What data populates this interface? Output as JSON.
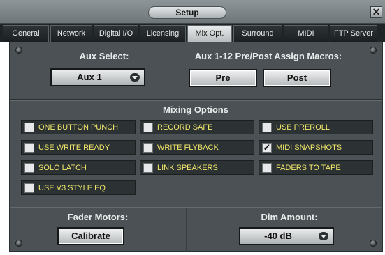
{
  "window": {
    "title": "Setup",
    "close_glyph": "✕"
  },
  "tabs": [
    {
      "label": "General",
      "active": false
    },
    {
      "label": "Network",
      "active": false
    },
    {
      "label": "Digital I/O",
      "active": false
    },
    {
      "label": "Licensing",
      "active": false
    },
    {
      "label": "Mix Opt.",
      "active": true
    },
    {
      "label": "Surround",
      "active": false
    },
    {
      "label": "MIDI",
      "active": false
    },
    {
      "label": "FTP Server",
      "active": false
    }
  ],
  "aux": {
    "select_heading": "Aux Select:",
    "select_value": "Aux 1",
    "macros_heading": "Aux 1-12 Pre/Post Assign Macros:",
    "pre_label": "Pre",
    "post_label": "Post"
  },
  "mixing": {
    "heading": "Mixing Options",
    "options": [
      {
        "label": "ONE BUTTON PUNCH",
        "checked": false
      },
      {
        "label": "RECORD SAFE",
        "checked": false
      },
      {
        "label": "USE PREROLL",
        "checked": false
      },
      {
        "label": "USE WRITE READY",
        "checked": false
      },
      {
        "label": "WRITE FLYBACK",
        "checked": false
      },
      {
        "label": "MIDI SNAPSHOTS",
        "checked": true
      },
      {
        "label": "SOLO LATCH",
        "checked": false
      },
      {
        "label": "LINK SPEAKERS",
        "checked": false
      },
      {
        "label": "FADERS TO TAPE",
        "checked": false
      },
      {
        "label": "USE V3 STYLE EQ",
        "checked": false
      }
    ]
  },
  "fader": {
    "heading": "Fader Motors:",
    "calibrate_label": "Calibrate"
  },
  "dim": {
    "heading": "Dim Amount:",
    "value": "-40 dB"
  },
  "colors": {
    "option_text": "#f2e86a",
    "panel": "#4b5154",
    "tab_bar": "#1f2426"
  }
}
